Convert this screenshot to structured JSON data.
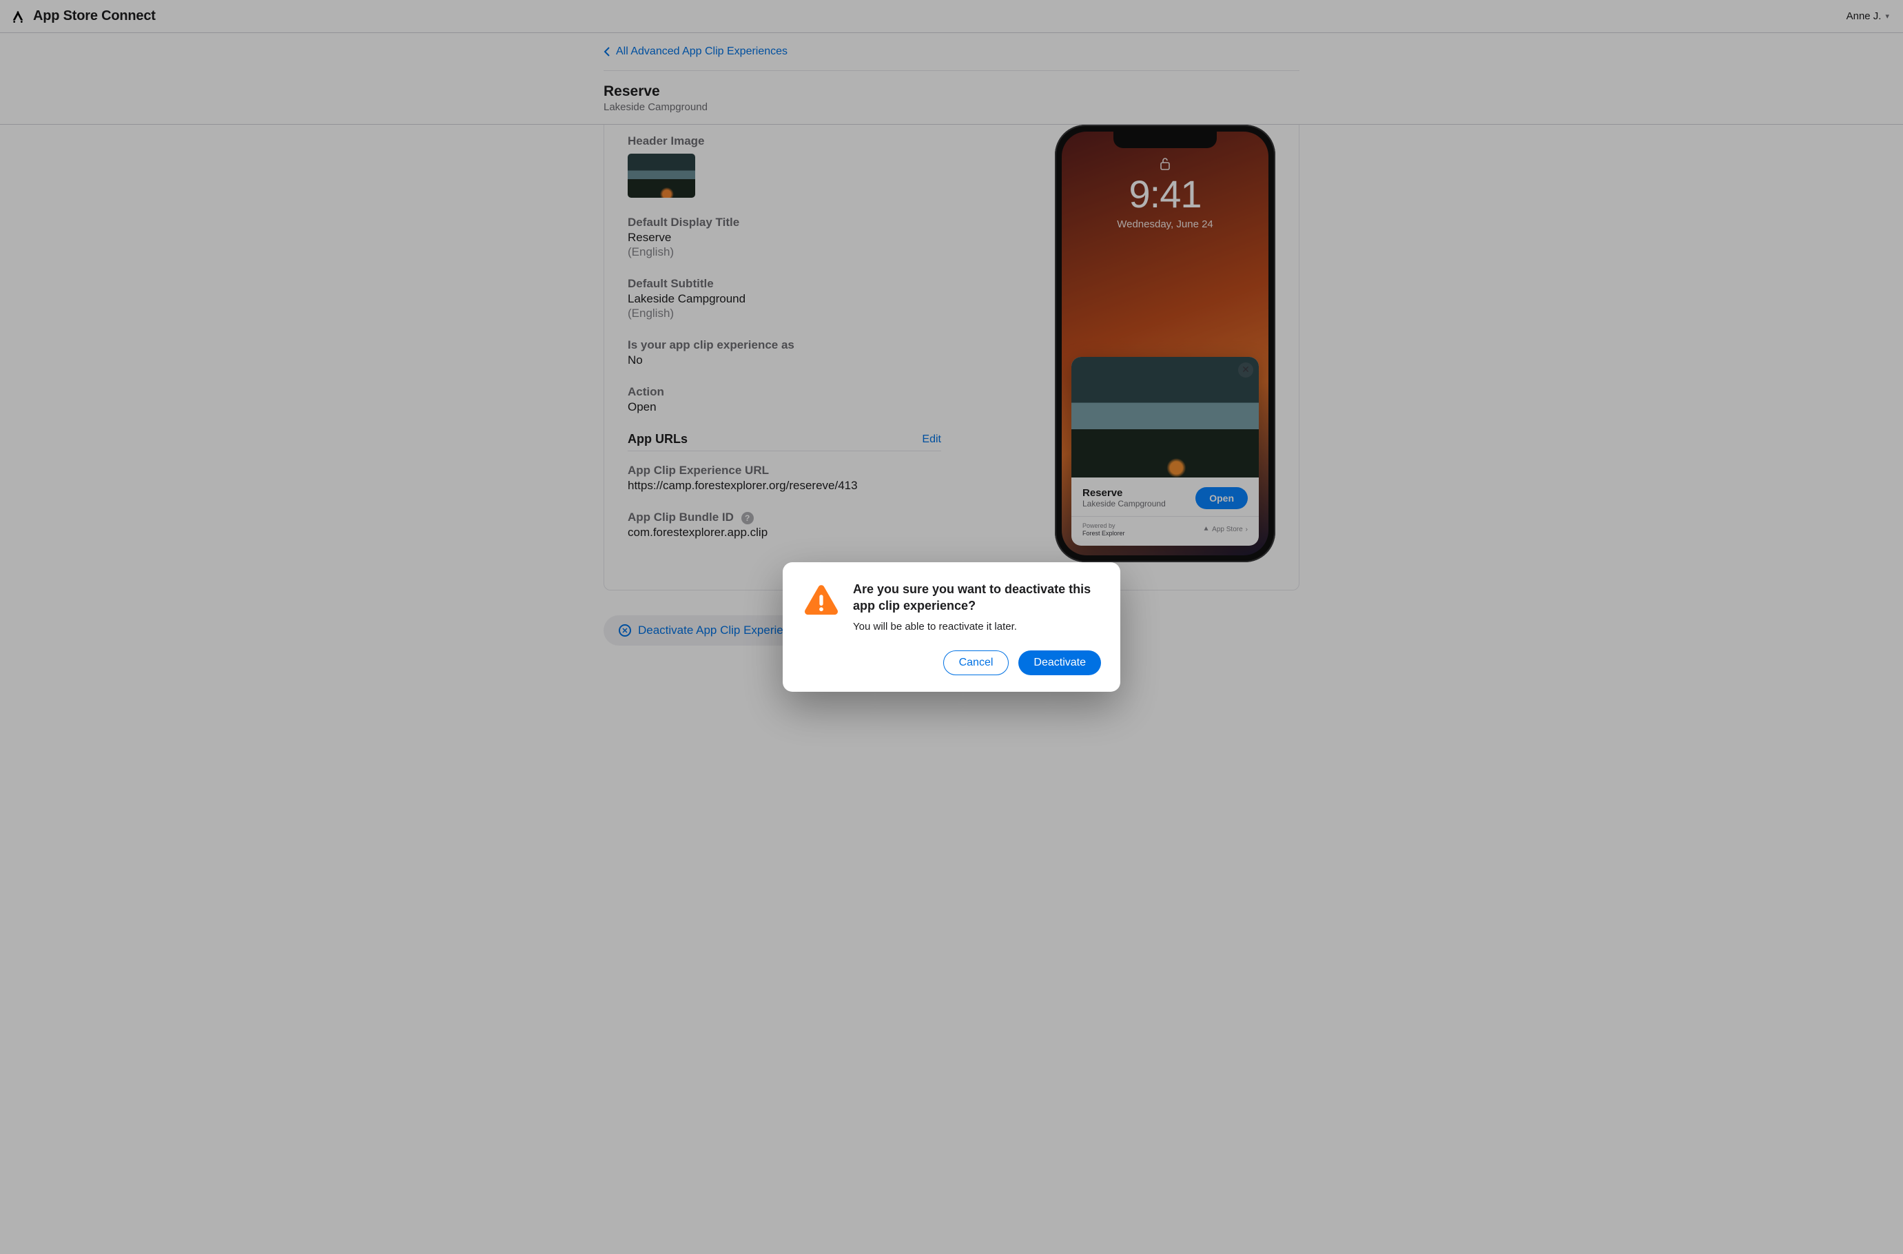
{
  "header": {
    "brand": "App Store Connect",
    "user_name": "Anne J."
  },
  "subheader": {
    "back_link": "All Advanced App Clip Experiences",
    "title": "Reserve",
    "subtitle": "Lakeside Campground"
  },
  "details": {
    "header_image_label": "Header Image",
    "default_display_title_label": "Default Display Title",
    "default_display_title_value": "Reserve",
    "default_display_title_lang": "(English)",
    "default_subtitle_label": "Default Subtitle",
    "default_subtitle_value": "Lakeside Campground",
    "default_subtitle_lang": "(English)",
    "business_assoc_label": "Is your app clip experience as",
    "business_assoc_value": "No",
    "action_label": "Action",
    "action_value": "Open"
  },
  "urls": {
    "section_title": "App URLs",
    "edit": "Edit",
    "experience_url_label": "App Clip Experience URL",
    "experience_url_value": "https://camp.forestexplorer.org/resereve/413",
    "bundle_id_label": "App Clip Bundle ID",
    "bundle_id_value": "com.forestexplorer.app.clip"
  },
  "phone": {
    "time": "9:41",
    "date": "Wednesday, June 24",
    "clip_title": "Reserve",
    "clip_subtitle": "Lakeside Campground",
    "open_label": "Open",
    "powered_by_label": "Powered by",
    "powered_by_value": "Forest Explorer",
    "appstore_label": "App Store"
  },
  "deactivate_pill": "Deactivate App Clip Experience",
  "modal": {
    "title": "Are you sure you want to deactivate this app clip experience?",
    "body": "You will be able to reactivate it later.",
    "cancel": "Cancel",
    "confirm": "Deactivate"
  }
}
